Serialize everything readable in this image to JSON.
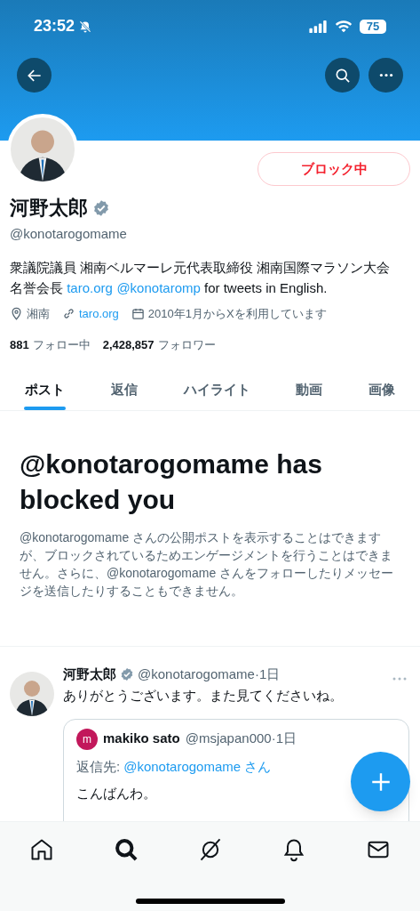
{
  "status_bar": {
    "time": "23:52",
    "battery": "75"
  },
  "profile": {
    "block_button": "ブロック中",
    "name": "河野太郎",
    "verified": true,
    "handle": "@konotarogomame",
    "bio": [
      {
        "kind": "text",
        "text": "衆議院議員 湘南ベルマーレ元代表取締役 湘南国際マラソン大会名誉会長 "
      },
      {
        "kind": "link",
        "text": "taro.org"
      },
      {
        "kind": "link",
        "text": "@konotaromp"
      },
      {
        "kind": "text",
        "text": " for tweets in English."
      }
    ],
    "location": "湘南",
    "website": "taro.org",
    "joined": "2010年1月からXを利用しています",
    "following_count": "881",
    "following_label": "フォロー中",
    "followers_count": "2,428,857",
    "followers_label": "フォロワー"
  },
  "tabs": [
    {
      "label": "ポスト",
      "selected": true
    },
    {
      "label": "返信",
      "selected": false
    },
    {
      "label": "ハイライト",
      "selected": false
    },
    {
      "label": "動画",
      "selected": false
    },
    {
      "label": "画像",
      "selected": false
    }
  ],
  "blocked_notice": {
    "title": "@konotarogomame has blocked you",
    "body": "@konotarogomame さんの公開ポストを表示することはできますが、ブロックされているためエンゲージメントを行うことはできません。さらに、@konotarogomame さんをフォローしたりメッセージを送信したりすることもできません。"
  },
  "post": {
    "name": "河野太郎",
    "verified": true,
    "meta": "@konotarogomame·1日",
    "text": "ありがとうございます。また見てくださいね。",
    "quote": {
      "avatar_letter": "m",
      "color": "#c2185b",
      "name": "makiko sato",
      "meta": "@msjapan000·1日",
      "reply_prefix": "返信先:",
      "reply_to": "@konotarogomame さん",
      "text": "こんばんわ。"
    }
  },
  "bottom_nav": [
    {
      "kind": "home",
      "selected": false
    },
    {
      "kind": "search",
      "selected": true
    },
    {
      "kind": "grok",
      "selected": false
    },
    {
      "kind": "notifications",
      "selected": false
    },
    {
      "kind": "messages",
      "selected": false
    }
  ]
}
